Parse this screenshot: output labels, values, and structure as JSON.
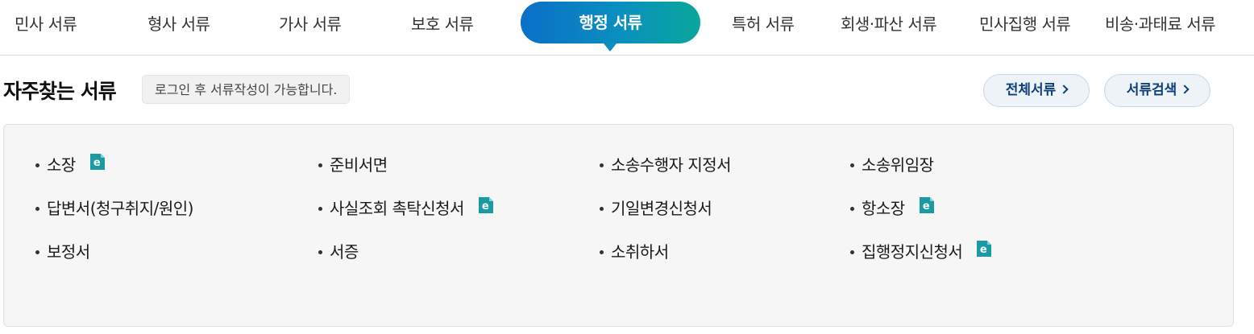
{
  "tabs": [
    {
      "label": "민사 서류"
    },
    {
      "label": "형사 서류"
    },
    {
      "label": "가사 서류"
    },
    {
      "label": "보호 서류"
    },
    {
      "label": "행정 서류",
      "active": true
    },
    {
      "label": "특허 서류"
    },
    {
      "label": "회생·파산 서류"
    },
    {
      "label": "민사집행 서류"
    },
    {
      "label": "비송·과태료 서류"
    }
  ],
  "section": {
    "title": "자주찾는 서류",
    "notice": "로그인 후 서류작성이 가능합니다."
  },
  "buttons": {
    "all_docs": "전체서류",
    "doc_search": "서류검색"
  },
  "documents": [
    {
      "label": "소장",
      "e_filing": true
    },
    {
      "label": "준비서면",
      "e_filing": false
    },
    {
      "label": "소송수행자 지정서",
      "e_filing": false
    },
    {
      "label": "소송위임장",
      "e_filing": false
    },
    {
      "label": "답변서(청구취지/원인)",
      "e_filing": false
    },
    {
      "label": "사실조회 촉탁신청서",
      "e_filing": true
    },
    {
      "label": "기일변경신청서",
      "e_filing": false
    },
    {
      "label": "항소장",
      "e_filing": true
    },
    {
      "label": "보정서",
      "e_filing": false
    },
    {
      "label": "서증",
      "e_filing": false
    },
    {
      "label": "소취하서",
      "e_filing": false
    },
    {
      "label": "집행정지신청서",
      "e_filing": true
    }
  ],
  "colors": {
    "active_tab_start": "#0a6fc8",
    "active_tab_end": "#0aa79c",
    "button_text": "#0e3f7a",
    "e_icon": "#1a9aa3"
  },
  "icons": {
    "e_filing": "e-document-icon",
    "chevron": "chevron-right-icon"
  }
}
